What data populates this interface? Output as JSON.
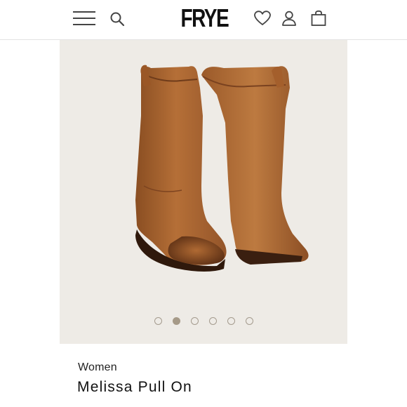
{
  "header": {
    "logo_text": "FRYE",
    "icons": {
      "menu": "hamburger-menu-icon",
      "search": "search-icon",
      "wishlist": "heart-icon",
      "account": "user-icon",
      "bag": "shopping-bag-icon"
    }
  },
  "gallery": {
    "image_subject": "brown leather pull-on boots",
    "slide_count": 6,
    "active_slide": 2,
    "colors": {
      "background": "#eeebe6",
      "active_dot": "#a69a88",
      "boot": "#a8622e"
    }
  },
  "product": {
    "category": "Women",
    "title": "Melissa Pull On"
  }
}
